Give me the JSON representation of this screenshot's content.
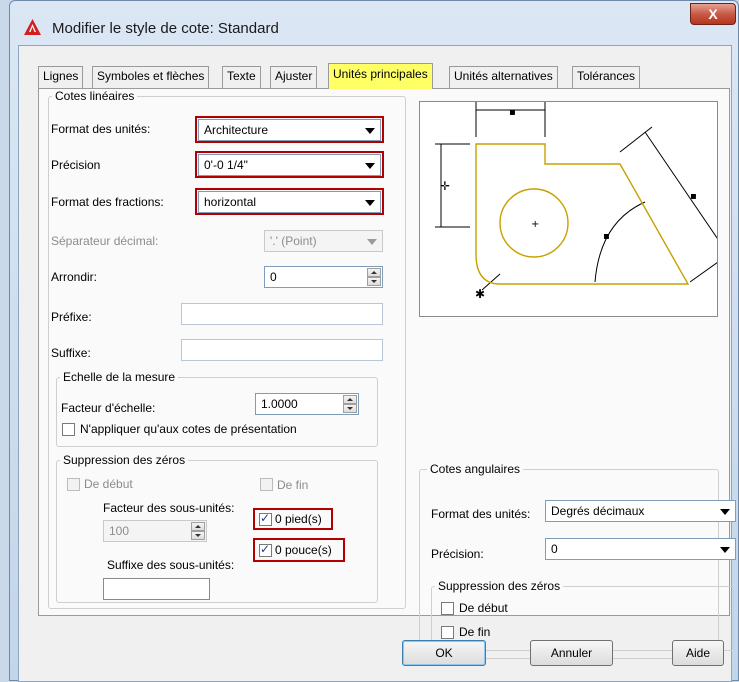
{
  "window": {
    "title": "Modifier le style de cote: Standard",
    "close_label": "X"
  },
  "tabs": [
    {
      "label": "Lignes"
    },
    {
      "label": "Symboles et flèches"
    },
    {
      "label": "Texte"
    },
    {
      "label": "Ajuster"
    },
    {
      "label": "Unités principales"
    },
    {
      "label": "Unités alternatives"
    },
    {
      "label": "Tolérances"
    }
  ],
  "active_tab": "Unités principales",
  "linear": {
    "group_label": "Cotes linéaires",
    "unit_format_label": "Format des unités:",
    "unit_format_value": "Architecture",
    "precision_label": "Précision",
    "precision_value": "0'-0 1/4\"",
    "fraction_format_label": "Format des fractions:",
    "fraction_format_value": "horizontal",
    "decimal_sep_label": "Séparateur décimal:",
    "decimal_sep_value": "'.' (Point)",
    "round_label": "Arrondir:",
    "round_value": "0",
    "prefix_label": "Préfixe:",
    "prefix_value": "",
    "suffix_label": "Suffixe:",
    "suffix_value": ""
  },
  "scale": {
    "group_label": "Echelle de la mesure",
    "factor_label": "Facteur d'échelle:",
    "factor_value": "1.0000",
    "layout_only_label": "N'appliquer qu'aux cotes de présentation",
    "layout_only_checked": false
  },
  "zero_suppression": {
    "group_label": "Suppression des zéros",
    "leading_label": "De début",
    "trailing_label": "De fin",
    "sub_factor_label": "Facteur des sous-unités:",
    "sub_factor_value": "100",
    "sub_suffix_label": "Suffixe des sous-unités:",
    "sub_suffix_value": "",
    "feet_label": "0 pied(s)",
    "feet_checked": true,
    "inches_label": "0 pouce(s)",
    "inches_checked": true
  },
  "angular": {
    "group_label": "Cotes angulaires",
    "unit_format_label": "Format des unités:",
    "unit_format_value": "Degrés décimaux",
    "precision_label": "Précision:",
    "precision_value": "0",
    "zero_group_label": "Suppression des zéros",
    "leading_label": "De début",
    "leading_checked": false,
    "trailing_label": "De fin",
    "trailing_checked": false
  },
  "buttons": {
    "ok": "OK",
    "cancel": "Annuler",
    "help": "Aide"
  },
  "colors": {
    "highlight": "#b00000",
    "active_tab": "#ffff66",
    "preview_geometry": "#c8a000",
    "close_button": "#c75a46"
  }
}
